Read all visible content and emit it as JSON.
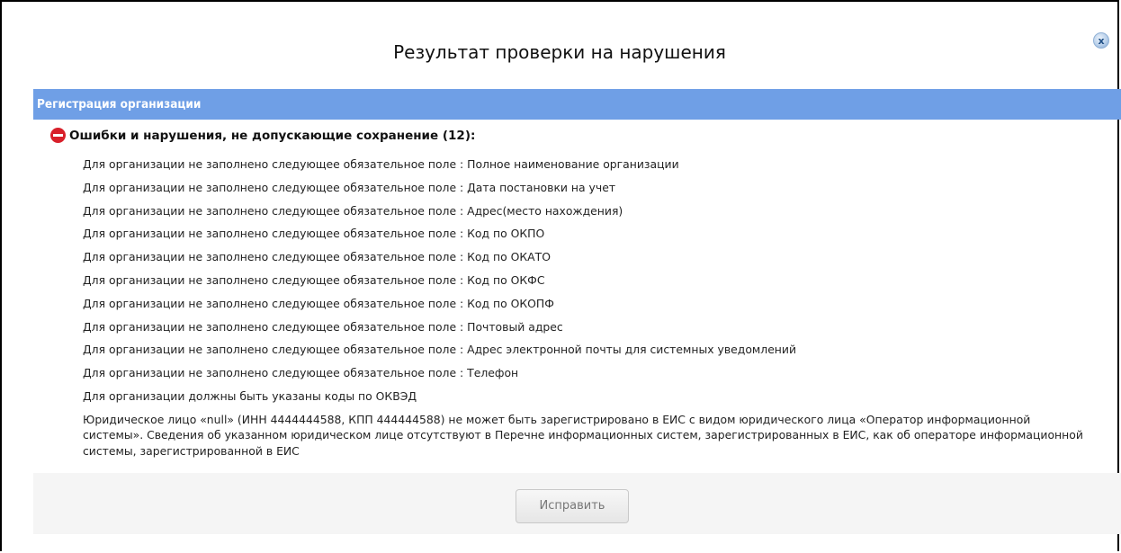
{
  "dialog": {
    "title": "Результат проверки на нарушения",
    "close_label": "x"
  },
  "section": {
    "header": "Регистрация организации"
  },
  "errors": {
    "icon": "error-stop-icon",
    "title": "Ошибки и нарушения, не допускающие сохранение (12):",
    "items": [
      "Для организации не заполнено следующее обязательное поле : Полное наименование организации",
      "Для организации не заполнено следующее обязательное поле : Дата постановки на учет",
      "Для организации не заполнено следующее обязательное поле : Адрес(место нахождения)",
      "Для организации не заполнено следующее обязательное поле : Код по ОКПО",
      "Для организации не заполнено следующее обязательное поле : Код по ОКАТО",
      "Для организации не заполнено следующее обязательное поле : Код по ОКФС",
      "Для организации не заполнено следующее обязательное поле : Код по ОКОПФ",
      "Для организации не заполнено следующее обязательное поле : Почтовый адрес",
      "Для организации не заполнено следующее обязательное поле : Адрес электронной почты для системных уведомлений",
      "Для организации не заполнено следующее обязательное поле : Телефон",
      "Для организации должны быть указаны коды по ОКВЭД",
      "Юридическое лицо «null» (ИНН 4444444588, КПП 444444588) не может быть зарегистрировано в ЕИС с видом юридического лица «Оператор информационной системы». Сведения об указанном юридическом лице отсутствуют в Перечне информационных систем, зарегистрированных в ЕИС, как об операторе информационной системы, зарегистрированной в ЕИС"
    ]
  },
  "footer": {
    "fix_button": "Исправить"
  },
  "colors": {
    "section_header_bg": "#6f9fe6",
    "error_icon": "#d8202a",
    "footer_bg": "#f5f5f5"
  }
}
